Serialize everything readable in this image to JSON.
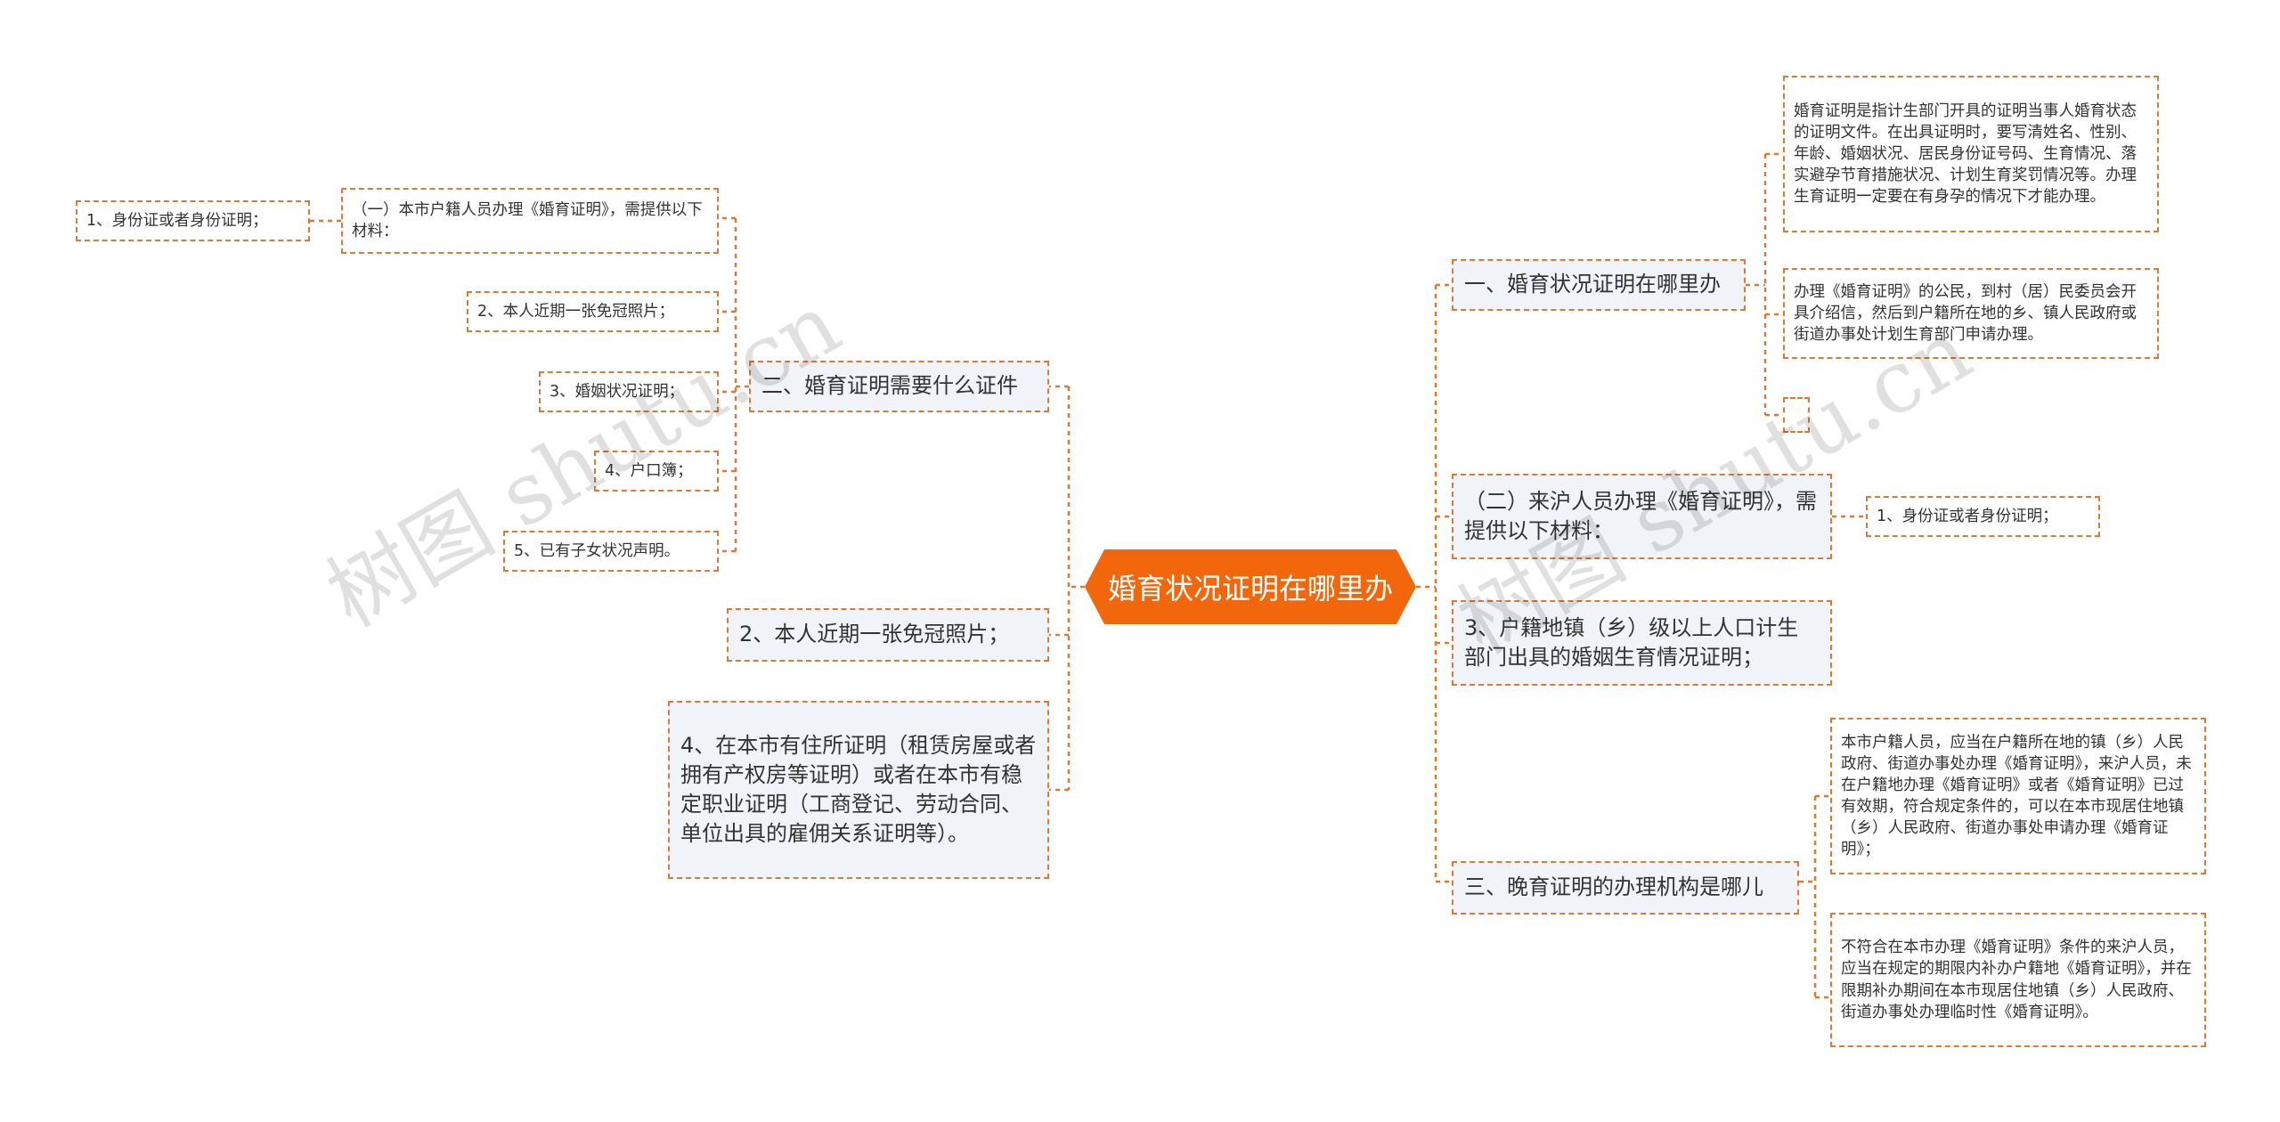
{
  "root": {
    "label": "婚育状况证明在哪里办"
  },
  "left": {
    "branch_docs": {
      "label": "二、婚育证明需要什么证件",
      "sub_local": {
        "label": "（一）本市户籍人员办理《婚育证明》，需提供以下材料：",
        "id_card": "1、身份证或者身份证明；"
      },
      "photo": "2、本人近期一张免冠照片；",
      "marital": "3、婚姻状况证明；",
      "hukou": "4、户口簿；",
      "children": "5、已有子女状况声明。"
    },
    "photo_big": "2、本人近期一张免冠照片；",
    "residence": "4、在本市有住所证明（租赁房屋或者拥有产权房等证明）或者在本市有稳定职业证明（工商登记、劳动合同、单位出具的雇佣关系证明等）。"
  },
  "right": {
    "where": {
      "label": "一、婚育状况证明在哪里办",
      "desc1": "婚育证明是指计生部门开具的证明当事人婚育状态的证明文件。在出具证明时，要写清姓名、性别、年龄、婚姻状况、居民身份证号码、生育情况、落实避孕节育措施状况、计划生育奖罚情况等。办理生育证明一定要在有身孕的情况下才能办理。",
      "desc2": "办理《婚育证明》的公民，到村（居）民委员会开具介绍信，然后到户籍所在地的乡、镇人民政府或街道办事处计划生育部门申请办理。",
      "empty": ""
    },
    "migrant": {
      "label": "（二）来沪人员办理《婚育证明》，需提供以下材料：",
      "id_card": "1、身份证或者身份证明；"
    },
    "hometown_cert": "3、户籍地镇（乡）级以上人口计生部门出具的婚姻生育情况证明；",
    "agency": {
      "label": "三、晚育证明的办理机构是哪儿",
      "desc1": "本市户籍人员，应当在户籍所在地的镇（乡）人民政府、街道办事处办理《婚育证明》，来沪人员，未在户籍地办理《婚育证明》或者《婚育证明》已过有效期，符合规定条件的，可以在本市现居住地镇（乡）人民政府、街道办事处申请办理《婚育证明》；",
      "desc2": "不符合在本市办理《婚育证明》条件的来沪人员，应当在规定的期限内补办户籍地《婚育证明》，并在限期补办期间在本市现居住地镇（乡）人民政府、街道办事处办理临时性《婚育证明》。"
    }
  },
  "watermark": [
    "树图 shutu.cn",
    "树图 shutu.cn"
  ],
  "colors": {
    "accent": "#f2660c",
    "border": "#e07a32",
    "l1_fill": "#f0f3f7"
  }
}
